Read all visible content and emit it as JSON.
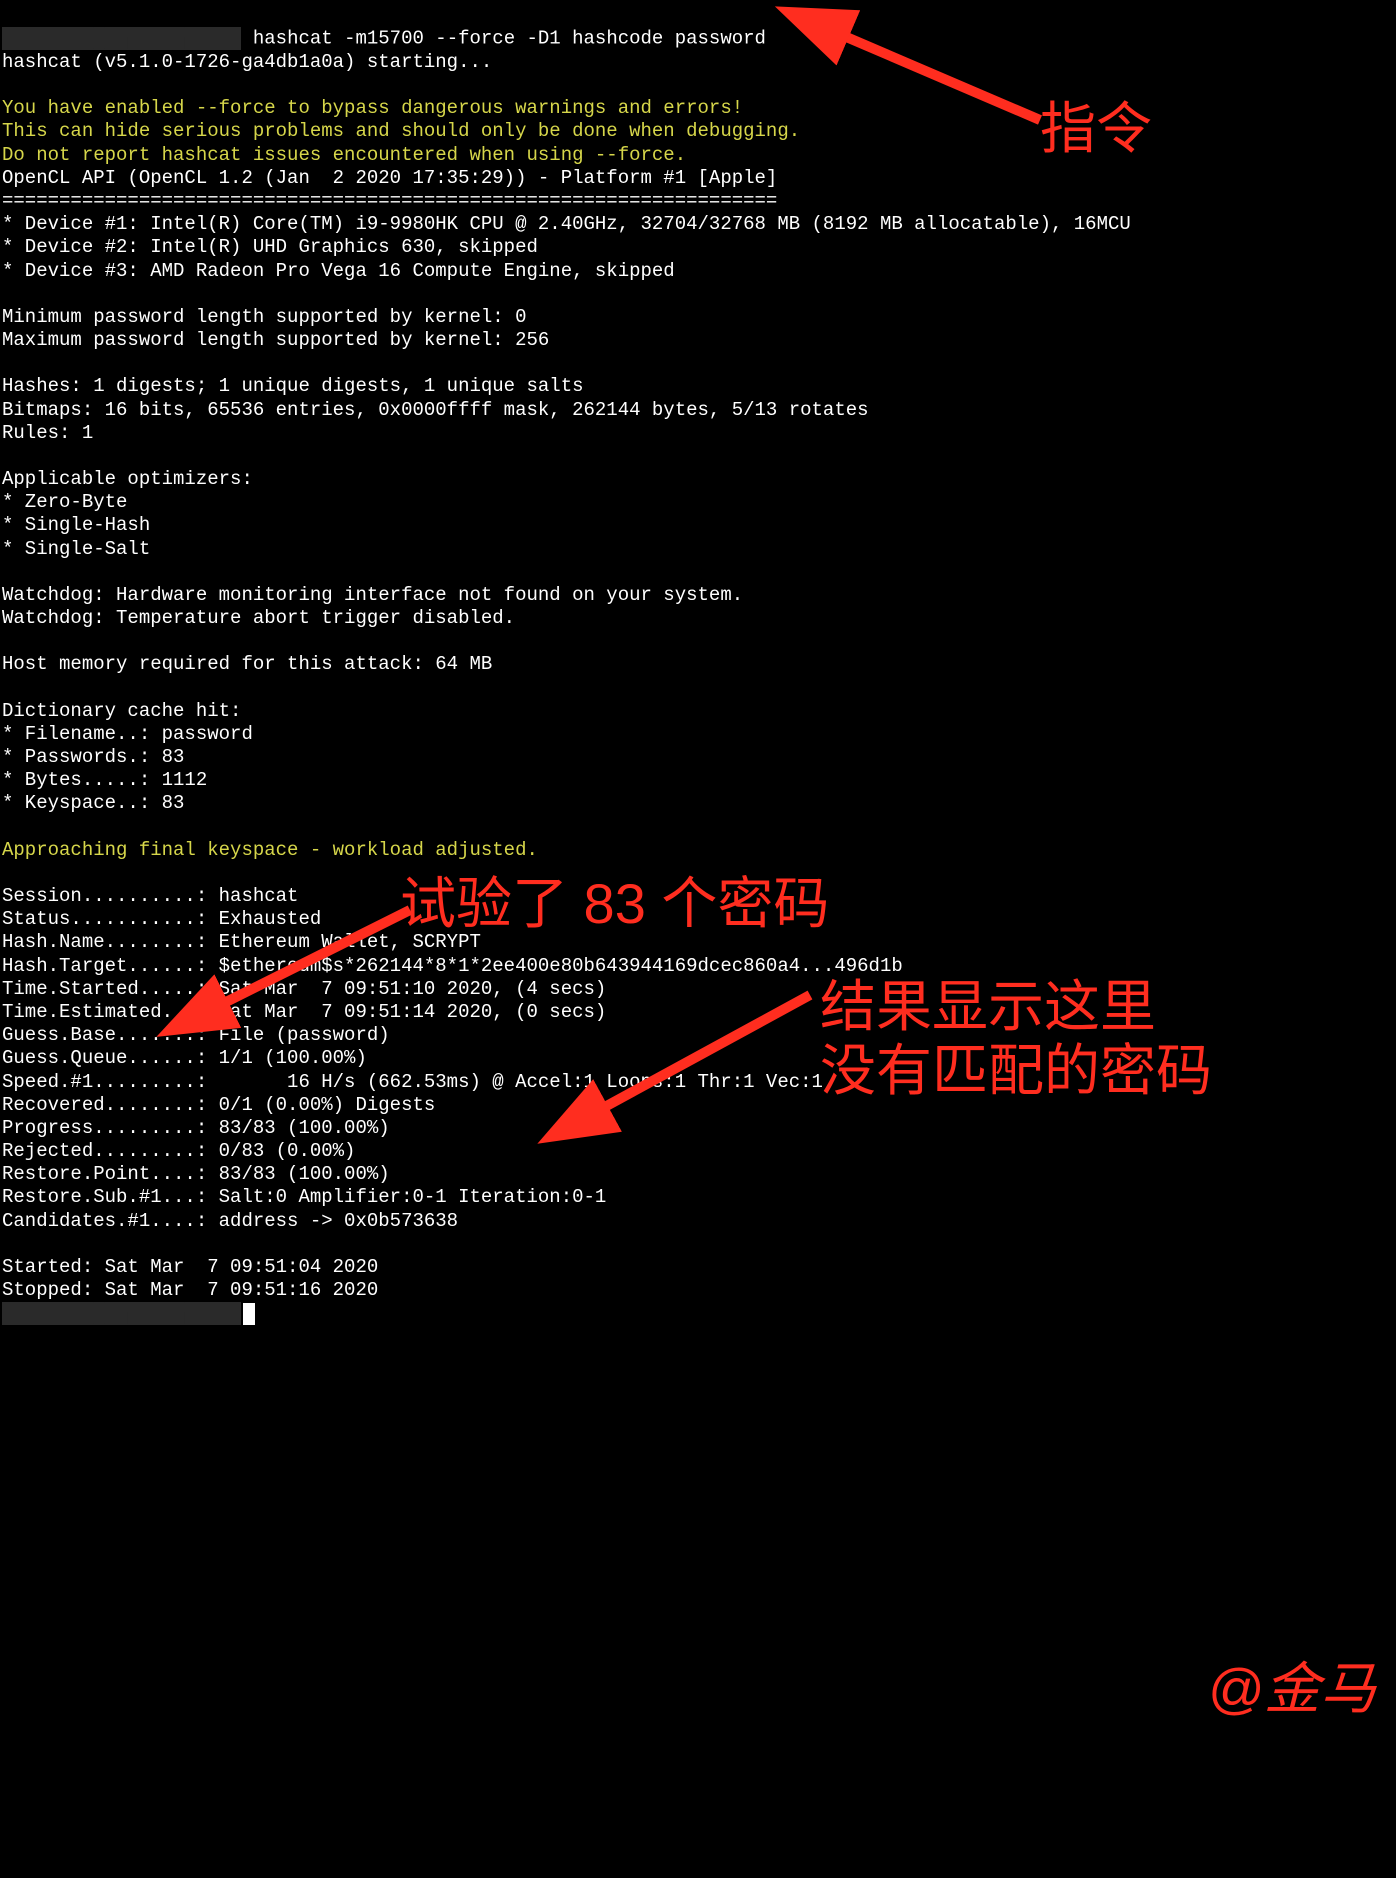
{
  "prompt_prefix_redacted": "                                 ",
  "command": "hashcat -m15700 --force -D1 hashcode password",
  "lines": {
    "starting": "hashcat (v5.1.0-1726-ga4db1a0a) starting...",
    "blank": "",
    "warn1": "You have enabled --force to bypass dangerous warnings and errors!",
    "warn2": "This can hide serious problems and should only be done when debugging.",
    "warn3": "Do not report hashcat issues encountered when using --force.",
    "opencl": "OpenCL API (OpenCL 1.2 (Jan  2 2020 17:35:29)) - Platform #1 [Apple]",
    "hr": "====================================================================",
    "dev1": "* Device #1: Intel(R) Core(TM) i9-9980HK CPU @ 2.40GHz, 32704/32768 MB (8192 MB allocatable), 16MCU",
    "dev2": "* Device #2: Intel(R) UHD Graphics 630, skipped",
    "dev3": "* Device #3: AMD Radeon Pro Vega 16 Compute Engine, skipped",
    "minlen": "Minimum password length supported by kernel: 0",
    "maxlen": "Maximum password length supported by kernel: 256",
    "hashes": "Hashes: 1 digests; 1 unique digests, 1 unique salts",
    "bitmaps": "Bitmaps: 16 bits, 65536 entries, 0x0000ffff mask, 262144 bytes, 5/13 rotates",
    "rules": "Rules: 1",
    "appopt": "Applicable optimizers:",
    "opt1": "* Zero-Byte",
    "opt2": "* Single-Hash",
    "opt3": "* Single-Salt",
    "wd1": "Watchdog: Hardware monitoring interface not found on your system.",
    "wd2": "Watchdog: Temperature abort trigger disabled.",
    "hostmem": "Host memory required for this attack: 64 MB",
    "dict": "Dictionary cache hit:",
    "d_file": "* Filename..: password",
    "d_pass": "* Passwords.: 83",
    "d_bytes": "* Bytes.....: 1112",
    "d_keysp": "* Keyspace..: 83",
    "approach": "Approaching final keyspace - workload adjusted.",
    "s_session": "Session..........: hashcat",
    "s_status": "Status...........: Exhausted",
    "s_hname": "Hash.Name........: Ethereum Wallet, SCRYPT",
    "s_htarget": "Hash.Target......: $ethereum$s*262144*8*1*2ee400e80b643944169dcec860a4...496d1b",
    "s_tstart": "Time.Started.....: Sat Mar  7 09:51:10 2020, (4 secs)",
    "s_testim": "Time.Estimated...: Sat Mar  7 09:51:14 2020, (0 secs)",
    "s_gbase": "Guess.Base.......: File (password)",
    "s_gqueue": "Guess.Queue......: 1/1 (100.00%)",
    "s_speed": "Speed.#1.........:       16 H/s (662.53ms) @ Accel:1 Loops:1 Thr:1 Vec:1",
    "s_recov": "Recovered........: 0/1 (0.00%) Digests",
    "s_prog": "Progress.........: 83/83 (100.00%)",
    "s_rej": "Rejected.........: 0/83 (0.00%)",
    "s_rpoint": "Restore.Point....: 83/83 (100.00%)",
    "s_rsub": "Restore.Sub.#1...: Salt:0 Amplifier:0-1 Iteration:0-1",
    "s_cand": "Candidates.#1....: address -> 0x0b573638",
    "started": "Started: Sat Mar  7 09:51:04 2020",
    "stopped": "Stopped: Sat Mar  7 09:51:16 2020"
  },
  "annotations": {
    "command_label": "指令",
    "tried_label": "试验了 83 个密码",
    "result_l1": "结果显示这里",
    "result_l2": "没有匹配的密码",
    "watermark": "@金马"
  }
}
